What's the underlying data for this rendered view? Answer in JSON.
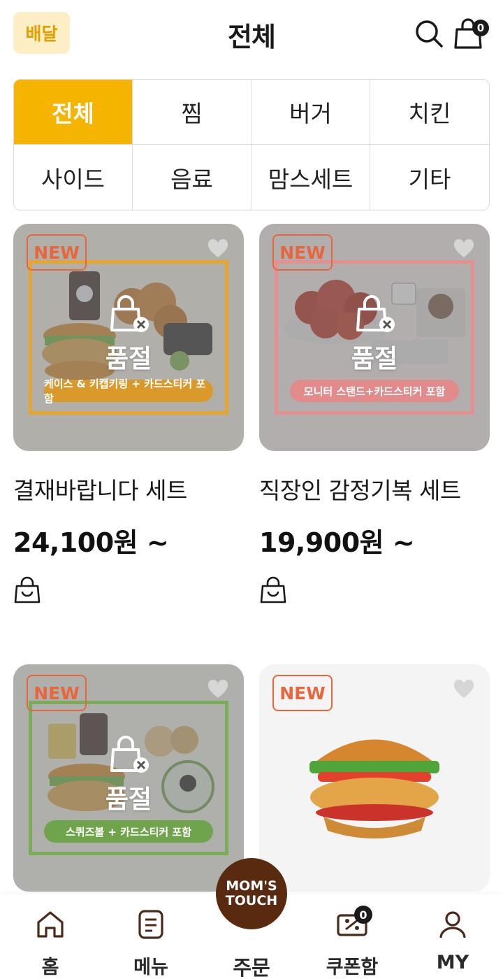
{
  "header": {
    "mode_badge": "배달",
    "title": "전체",
    "cart_count": "0"
  },
  "categories": [
    {
      "label": "전체",
      "active": true
    },
    {
      "label": "찜",
      "active": false
    },
    {
      "label": "버거",
      "active": false
    },
    {
      "label": "치킨",
      "active": false
    },
    {
      "label": "사이드",
      "active": false
    },
    {
      "label": "음료",
      "active": false
    },
    {
      "label": "맘스세트",
      "active": false
    },
    {
      "label": "기타",
      "active": false
    }
  ],
  "products": [
    {
      "badge": "NEW",
      "name": "결재바랍니다 세트",
      "price": "24,100원 ~",
      "status": "품절",
      "promo": "케이스 & 키캡키링 + 카드스티커 포함",
      "promo_color": "#d99a2b",
      "frame_color": "#e6a531",
      "sold_out": true
    },
    {
      "badge": "NEW",
      "name": "직장인 감정기복 세트",
      "price": "19,900원 ~",
      "status": "품절",
      "promo": "모니터 스탠드+카드스티커 포함",
      "promo_color": "#e38a8a",
      "frame_color": "#e58f90",
      "sold_out": true
    },
    {
      "badge": "NEW",
      "status": "품절",
      "promo": "스퀴즈볼 + 카드스티커 포함",
      "promo_color": "#6fa34c",
      "frame_color": "#7aac5a",
      "sold_out": true
    },
    {
      "badge": "NEW",
      "sold_out": false
    }
  ],
  "bottom_nav": {
    "home": "홈",
    "menu": "메뉴",
    "order": "주문",
    "coupon": "쿠폰함",
    "coupon_count": "0",
    "my": "MY",
    "brand_line1": "MOM'S",
    "brand_line2": "TOUCH"
  },
  "colors": {
    "accent": "#f4b400",
    "new_badge": "#e8663c",
    "brand": "#5a2a10"
  }
}
